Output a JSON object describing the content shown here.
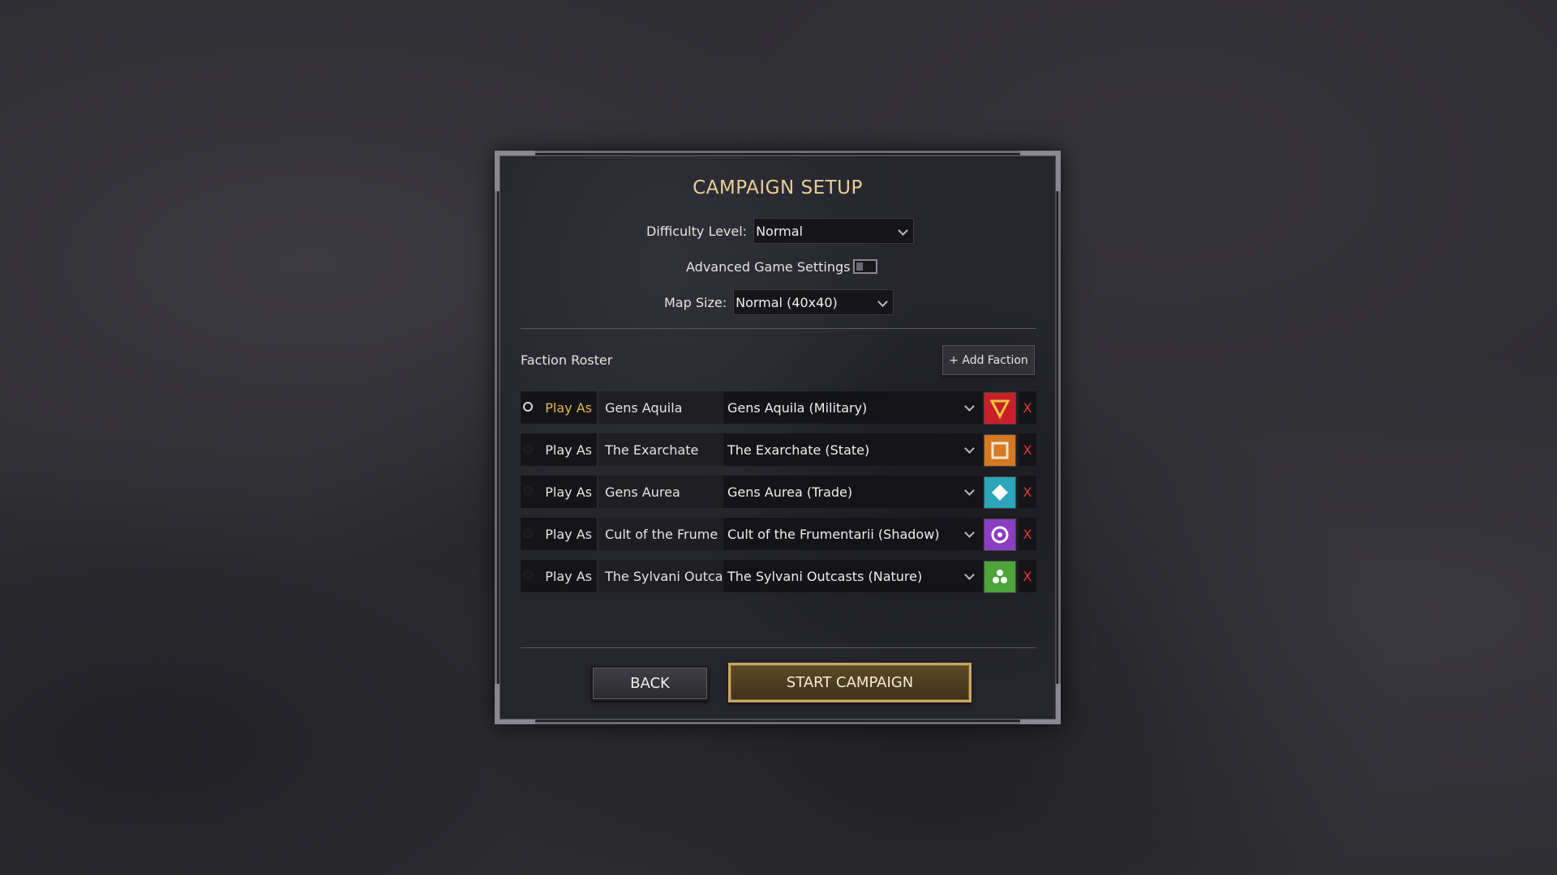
{
  "title": "CAMPAIGN SETUP",
  "difficulty": {
    "label": "Difficulty Level:",
    "value": "Normal"
  },
  "advanced": {
    "label": "Advanced Game Settings",
    "enabled": false
  },
  "map_size": {
    "label": "Map Size:",
    "value": "Normal (40x40)"
  },
  "roster": {
    "label": "Faction Roster",
    "add_label": "+ Add Faction",
    "factions": [
      {
        "play_label": "Play As",
        "name": "Gens Aquila",
        "type": "Gens Aquila (Military)",
        "selected": true,
        "icon": "triangle-down-icon",
        "color": "#c8202a",
        "remove": "X"
      },
      {
        "play_label": "Play As",
        "name": "The Exarchate",
        "type": "The Exarchate (State)",
        "selected": false,
        "icon": "square-icon",
        "color": "#d47a23",
        "remove": "X"
      },
      {
        "play_label": "Play As",
        "name": "Gens Aurea",
        "type": "Gens Aurea (Trade)",
        "selected": false,
        "icon": "diamond-icon",
        "color": "#2aa6b8",
        "remove": "X"
      },
      {
        "play_label": "Play As",
        "name": "Cult of the Frume",
        "type": "Cult of the Frumentarii (Shadow)",
        "selected": false,
        "icon": "circle-target-icon",
        "color": "#8a3ec2",
        "remove": "X"
      },
      {
        "play_label": "Play As",
        "name": "The Sylvani Outca",
        "type": "The Sylvani Outcasts (Nature)",
        "selected": false,
        "icon": "three-dots-icon",
        "color": "#4ea43a",
        "remove": "X"
      }
    ]
  },
  "buttons": {
    "back": "BACK",
    "start": "START CAMPAIGN"
  }
}
